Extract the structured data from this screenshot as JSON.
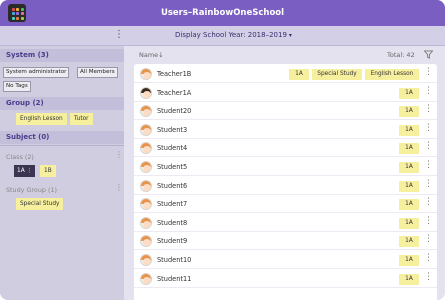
{
  "window": {
    "title": "Users–RainbowOneSchool"
  },
  "colors": {
    "accent": "#7a5ec2",
    "tag_yellow": "#f6ef9e"
  },
  "subheader": {
    "year_label": "Display School Year: 2018–2019",
    "caret": "▾",
    "menu_icon": "⋮"
  },
  "sidebar": {
    "system": {
      "title": "System (3)",
      "chips": [
        "System administrator",
        "All Members",
        "No Tags"
      ]
    },
    "group": {
      "title": "Group (2)",
      "chips": [
        "English Lesson",
        "Tutor"
      ]
    },
    "subject": {
      "title": "Subject (0)"
    },
    "class": {
      "title": "Class (2)",
      "menu_icon": "⋮",
      "chips": [
        "1A ⋮",
        "1B"
      ]
    },
    "study_group": {
      "title": "Study Group (1)",
      "menu_icon": "⋮",
      "chips": [
        "Special Study"
      ]
    }
  },
  "list": {
    "name_header": "Name↓",
    "total": "Total: 42",
    "filter_icon": "filter-icon",
    "row_menu_icon": "⋮",
    "rows": [
      {
        "name": "Teacher1B",
        "tags": [
          "1A",
          "Special Study",
          "English Lesson"
        ]
      },
      {
        "name": "Teacher1A",
        "tags": [
          "1A"
        ]
      },
      {
        "name": "Student20",
        "tags": [
          "1A"
        ]
      },
      {
        "name": "Student3",
        "tags": [
          "1A"
        ]
      },
      {
        "name": "Student4",
        "tags": [
          "1A"
        ]
      },
      {
        "name": "Student5",
        "tags": [
          "1A"
        ]
      },
      {
        "name": "Student6",
        "tags": [
          "1A"
        ]
      },
      {
        "name": "Student7",
        "tags": [
          "1A"
        ]
      },
      {
        "name": "Student8",
        "tags": [
          "1A"
        ]
      },
      {
        "name": "Student9",
        "tags": [
          "1A"
        ]
      },
      {
        "name": "Student10",
        "tags": [
          "1A"
        ]
      },
      {
        "name": "Student11",
        "tags": [
          "1A"
        ]
      }
    ]
  }
}
